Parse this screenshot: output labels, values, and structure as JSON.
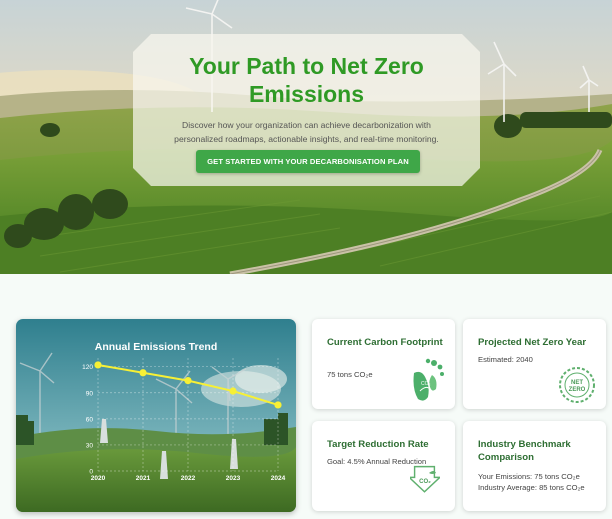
{
  "hero": {
    "title": "Your Path to Net Zero Emissions",
    "description": "Discover how your organization can achieve decarbonization with personalized roadmaps, actionable insights, and real-time monitoring.",
    "cta_label": "GET STARTED WITH YOUR DECARBONISATION PLAN"
  },
  "cards": {
    "carbon_footprint": {
      "title": "Current Carbon Footprint",
      "value": "75 tons CO₂e",
      "icon": "footprint-icon"
    },
    "net_zero_year": {
      "title": "Projected Net Zero Year",
      "value": "Estimated: 2040",
      "icon": "net-zero-badge-icon",
      "badge_text": "NET ZERO"
    },
    "reduction_rate": {
      "title": "Target Reduction Rate",
      "value": "Goal: 4.5% Annual Reduction",
      "icon": "co2-down-arrow-icon"
    },
    "benchmark": {
      "title": "Industry Benchmark Comparison",
      "line1": "Your Emissions: 75 tons CO₂e",
      "line2": "Industry Average: 85 tons CO₂e"
    }
  },
  "chart_data": {
    "type": "line",
    "title": "Annual Emissions Trend",
    "x": [
      "2020",
      "2021",
      "2022",
      "2023",
      "2024"
    ],
    "series": [
      {
        "values": [
          122,
          113,
          104,
          92,
          76
        ]
      }
    ],
    "yticks": [
      0,
      30,
      60,
      90,
      120
    ],
    "ylim": [
      0,
      130
    ],
    "grid": true,
    "line_color": "#f7f035",
    "legend": "none"
  }
}
